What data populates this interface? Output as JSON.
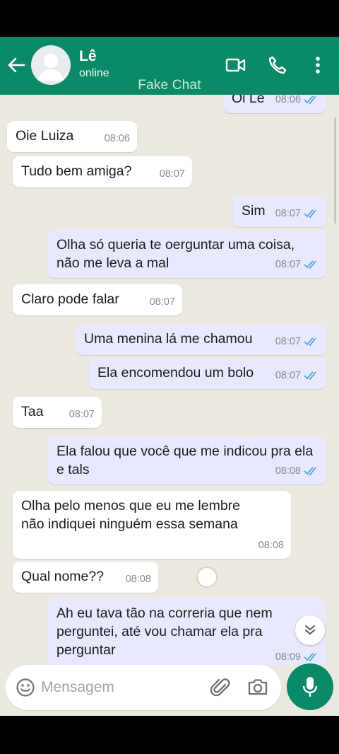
{
  "header": {
    "contact_name": "Lê",
    "contact_status": "online",
    "watermark": "Fake Chat",
    "colors": {
      "header_bg": "#0a8a67",
      "chat_bg": "#ebe8e0",
      "outgoing_bubble": "#e8e8ff",
      "incoming_bubble": "#ffffff",
      "read_ticks": "#4fa3e0"
    },
    "icons": [
      "back-arrow-icon",
      "avatar",
      "video-call-icon",
      "phone-icon",
      "more-vert-icon"
    ]
  },
  "messages": [
    {
      "dir": "out",
      "text": "Oi Lê",
      "time": "08:06",
      "read": true
    },
    {
      "dir": "in",
      "text": "Oie Luiza",
      "time": "08:06"
    },
    {
      "dir": "in",
      "text": "Tudo bem amiga?",
      "time": "08:07"
    },
    {
      "dir": "out",
      "text": "Sim",
      "time": "08:07",
      "read": true
    },
    {
      "dir": "out",
      "text": "Olha só queria te oerguntar uma coisa, não me leva a mal",
      "time": "08:07",
      "read": true
    },
    {
      "dir": "in",
      "text": "Claro pode falar",
      "time": "08:07"
    },
    {
      "dir": "out",
      "text": "Uma menina lá me chamou",
      "time": "08:07",
      "read": true
    },
    {
      "dir": "out",
      "text": "Ela encomendou um bolo",
      "time": "08:07",
      "read": true
    },
    {
      "dir": "in",
      "text": "Taa",
      "time": "08:07"
    },
    {
      "dir": "out",
      "text": "Ela falou que você que me  indicou pra ela e tals",
      "time": "08:08",
      "read": true
    },
    {
      "dir": "in",
      "text": "Olha pelo menos que eu me lembre não indiquei ninguém essa semana",
      "time": "08:08"
    },
    {
      "dir": "in",
      "text": "Qual nome??",
      "time": "08:08"
    },
    {
      "dir": "out",
      "text": "Ah eu tava tão na correria que nem perguntei, até vou chamar ela pra perguntar",
      "time": "08:09",
      "read": true
    }
  ],
  "composer": {
    "placeholder": "Mensagem",
    "icons": [
      "emoji-icon",
      "attach-icon",
      "camera-icon",
      "mic-icon"
    ]
  },
  "scroll_down_icon": "chevrons-down-icon"
}
